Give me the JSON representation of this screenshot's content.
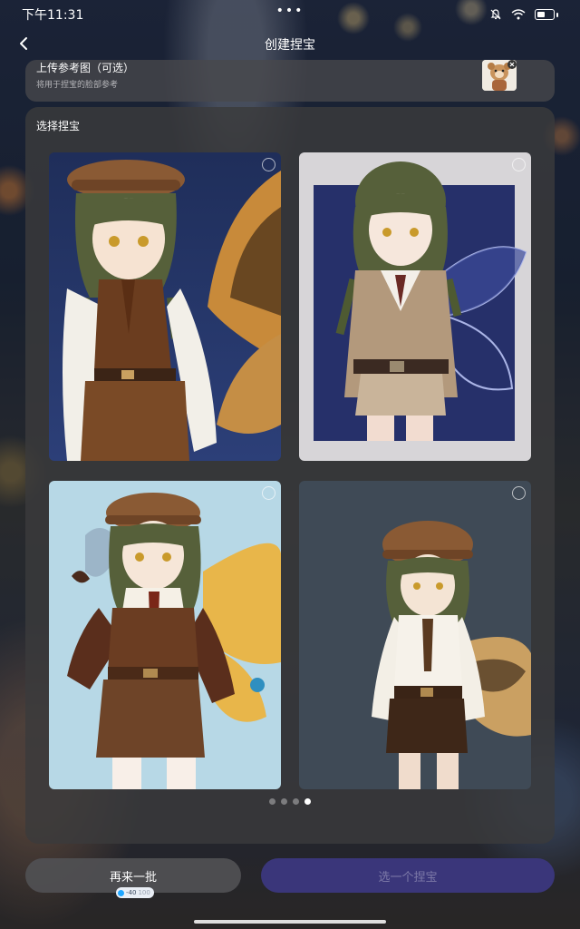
{
  "status_bar": {
    "time": "下午11:31",
    "center_dots": "•••",
    "icons": [
      "mute-bell-icon",
      "wifi-icon",
      "battery-icon"
    ]
  },
  "nav": {
    "title": "创建捏宝",
    "back_icon": "chevron-left-icon"
  },
  "upload": {
    "title": "上传参考图（可选）",
    "subtitle": "将用于捏宝的脸部参考",
    "remove_icon": "close-icon"
  },
  "select": {
    "title": "选择捏宝",
    "options": [
      {
        "id": "option-1",
        "selected": false
      },
      {
        "id": "option-2",
        "selected": false
      },
      {
        "id": "option-3",
        "selected": false
      },
      {
        "id": "option-4",
        "selected": false
      }
    ],
    "pagination": {
      "pages": 4,
      "current": 4
    }
  },
  "actions": {
    "regenerate_label": "再来一批",
    "cost_value": "-40",
    "cost_total": "100",
    "choose_label": "选一个捏宝"
  },
  "colors": {
    "primary_disabled": "#3a367a",
    "panel": "#3a3a3c"
  }
}
